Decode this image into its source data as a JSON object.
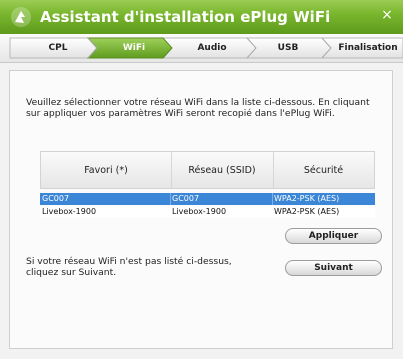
{
  "window": {
    "title": "Assistant d'installation ePlug WiFi",
    "close_glyph": "×",
    "accent_color": "#7ab72e"
  },
  "steps": [
    {
      "label": "CPL",
      "active": false
    },
    {
      "label": "WiFi",
      "active": true
    },
    {
      "label": "Audio",
      "active": false
    },
    {
      "label": "USB",
      "active": false
    },
    {
      "label": "Finalisation",
      "active": false
    }
  ],
  "intro_text": "Veuillez sélectionner votre réseau WiFi dans la liste ci-dessous. En cliquant sur appliquer vos paramètres WiFi seront recopié dans l'ePlug WiFi.",
  "table": {
    "headers": [
      "Favori (*)",
      "Réseau (SSID)",
      "Sécurité"
    ],
    "rows": [
      {
        "favori": "GC007",
        "ssid": "GC007",
        "securite": "WPA2-PSK (AES)",
        "selected": true
      },
      {
        "favori": "Livebox-1900",
        "ssid": "Livebox-1900",
        "securite": "WPA2-PSK (AES)",
        "selected": false
      }
    ],
    "selection_color": "#3b86d6"
  },
  "buttons": {
    "apply_label": "Appliquer",
    "next_label": "Suivant"
  },
  "note_text": "Si votre réseau WiFi n'est pas listé ci-dessus, cliquez sur Suivant."
}
